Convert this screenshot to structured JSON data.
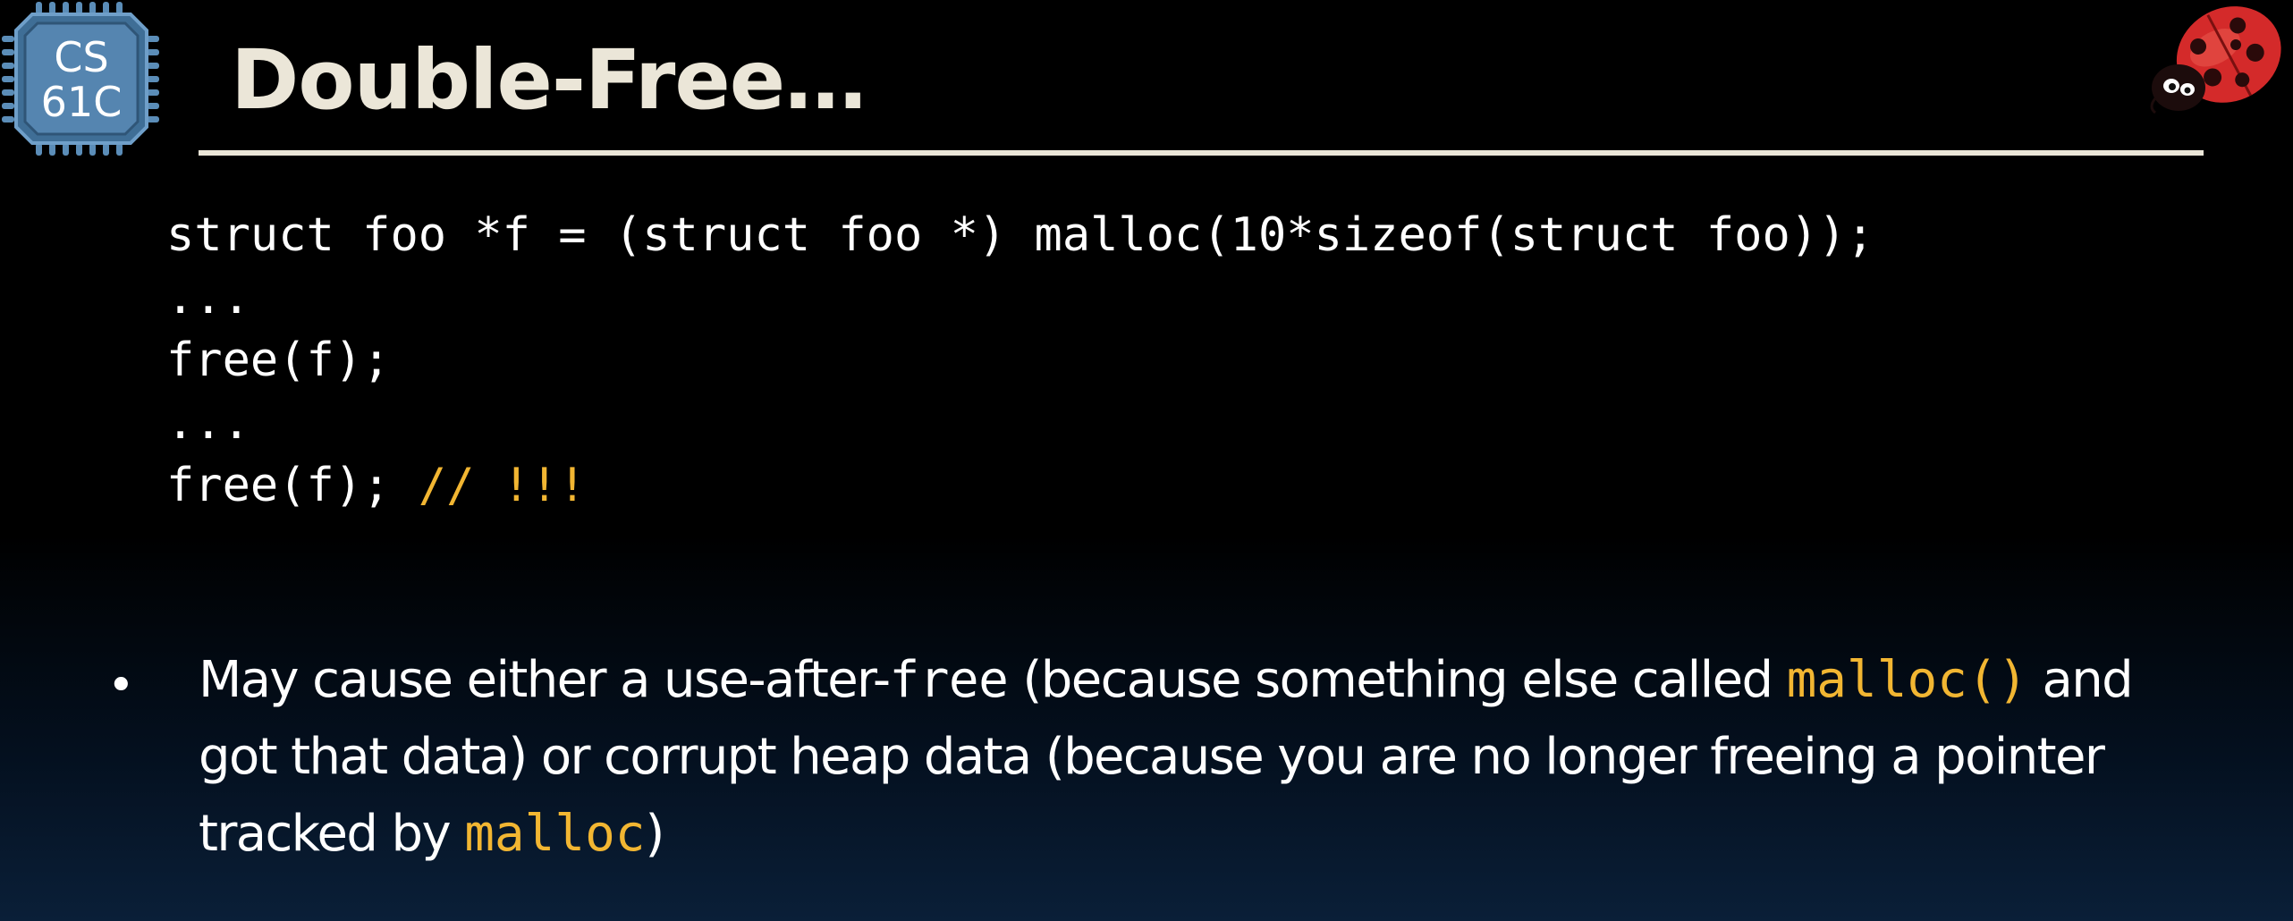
{
  "logo": {
    "line1": "CS",
    "line2": "61C",
    "icon": "cs61c-chip-logo"
  },
  "decoration": {
    "icon": "ladybug-icon"
  },
  "title": "Double-Free…",
  "code": {
    "lines": [
      "struct foo *f = (struct foo *) malloc(10*sizeof(struct foo));",
      "...",
      "free(f);",
      "...",
      "free(f); "
    ],
    "comment": "// !!!"
  },
  "bullet": {
    "marker": "•",
    "segments": [
      "May cause either a use-after-",
      "free",
      " (because something else called ",
      "malloc()",
      " and got that data) or corrupt heap data (because you are no longer freeing a pointer tracked by ",
      "malloc",
      ")"
    ]
  },
  "colors": {
    "background": "#000000",
    "title": "#ebe6d8",
    "accent": "#f2b632",
    "logo_blue": "#4a7ba6"
  }
}
